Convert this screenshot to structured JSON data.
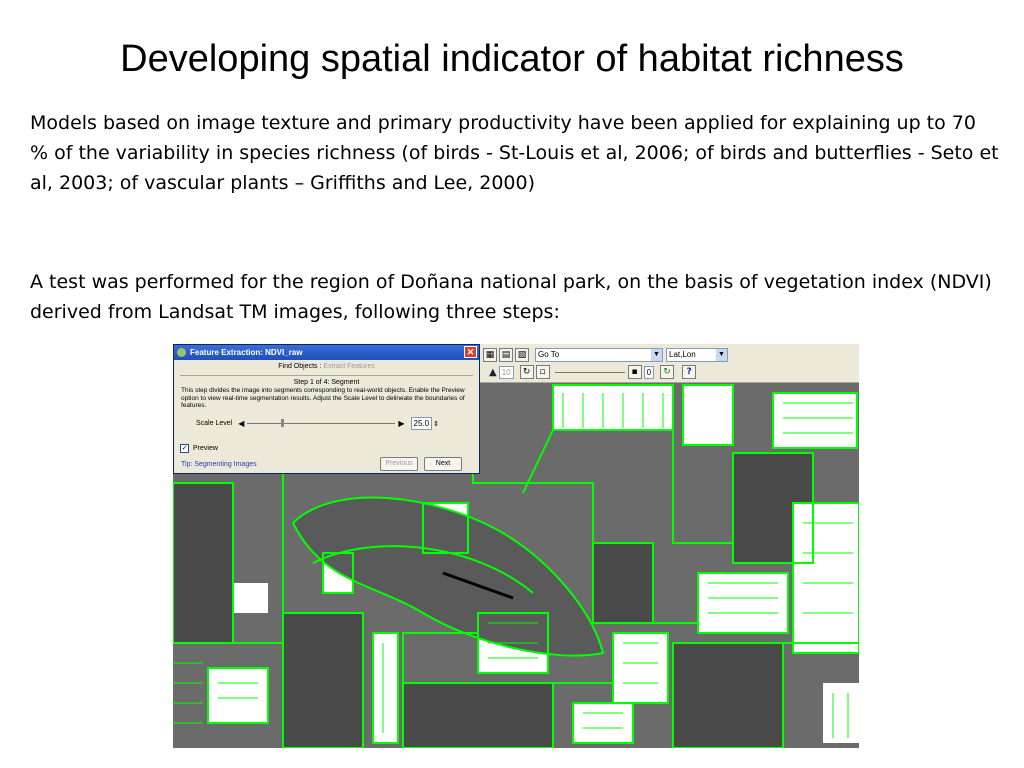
{
  "slide": {
    "title": "Developing spatial indicator of habitat richness",
    "paragraph1": "Models based on image texture and primary productivity have been applied for explaining up to 70 % of the variability in species richness (of birds - St-Louis et al, 2006; of birds and butterflies - Seto et al, 2003; of vascular plants – Griffiths and Lee, 2000)",
    "paragraph2": "A test was performed for the region of Doñana national park, on the basis of vegetation index (NDVI) derived from Landsat TM images, following three steps:"
  },
  "toolbar": {
    "goto_value": "Go To",
    "coord_value": "Lat,Lon",
    "field_a": "10",
    "field_b": "0",
    "help_label": "?"
  },
  "dialog": {
    "title": "Feature Extraction: NDVI_raw",
    "close_label": "✕",
    "tab_active": "Find Objects",
    "tab_separator": " : ",
    "tab_inactive": "Extract Features",
    "step": "Step 1 of 4: Segment",
    "description": "This step divides the image into segments corresponding to real-world objects. Enable the Preview option to view real-time segmentation results. Adjust the Scale Level to delineate the boundaries of features.",
    "scale_label": "Scale Level",
    "scale_value": "25.0",
    "preview_label": "Preview",
    "preview_checked": true,
    "tip": "Tip: Segmenting Images",
    "previous_button": "Previous",
    "next_button": "Next"
  },
  "icons": [
    "dialog-app-icon",
    "close-icon",
    "arrow-left-icon",
    "arrow-right-icon",
    "spin-icon",
    "check-icon",
    "triangle-icon",
    "refresh-icon",
    "help-icon"
  ],
  "colors": {
    "segment_lines": "#00ff00",
    "field_white": "#ffffff",
    "field_dark": "#4a4a4a",
    "title_bar": "#2a5cc8",
    "dialog_bg": "#ece9d8",
    "tip_text": "#2040c0"
  }
}
